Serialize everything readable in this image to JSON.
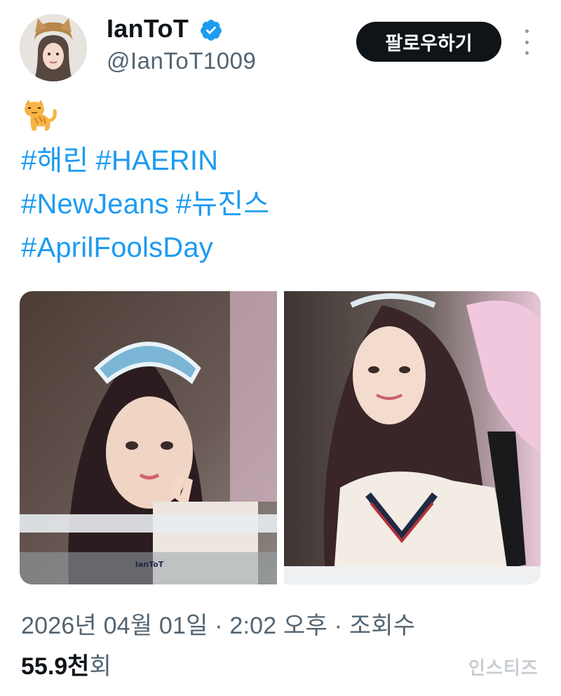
{
  "author": {
    "display_name": "IanToT",
    "handle": "@IanToT1009",
    "verified_icon": "verified-badge-icon",
    "avatar_icon": "profile-avatar"
  },
  "follow_button": {
    "label": "팔로우하기"
  },
  "more_icon": "more-options-icon",
  "post": {
    "emoji": "cat-emoji",
    "hashtag_lines": [
      [
        "#해린",
        "#HAERIN"
      ],
      [
        "#NewJeans",
        "#뉴진스"
      ],
      [
        "#AprilFoolsDay"
      ]
    ]
  },
  "media": {
    "photo_left": {
      "watermark": "IanToT"
    },
    "photo_right": {}
  },
  "footer": {
    "timestamp": "2026년 04월 01일 · 2:02 오후 · 조회수",
    "views_value": "55.9천",
    "views_label": "회"
  },
  "watermark_corner": "인스티즈",
  "colors": {
    "link": "#1d9bf0",
    "text_primary": "#0f1419",
    "text_secondary": "#536471",
    "button_bg": "#0f1419"
  }
}
